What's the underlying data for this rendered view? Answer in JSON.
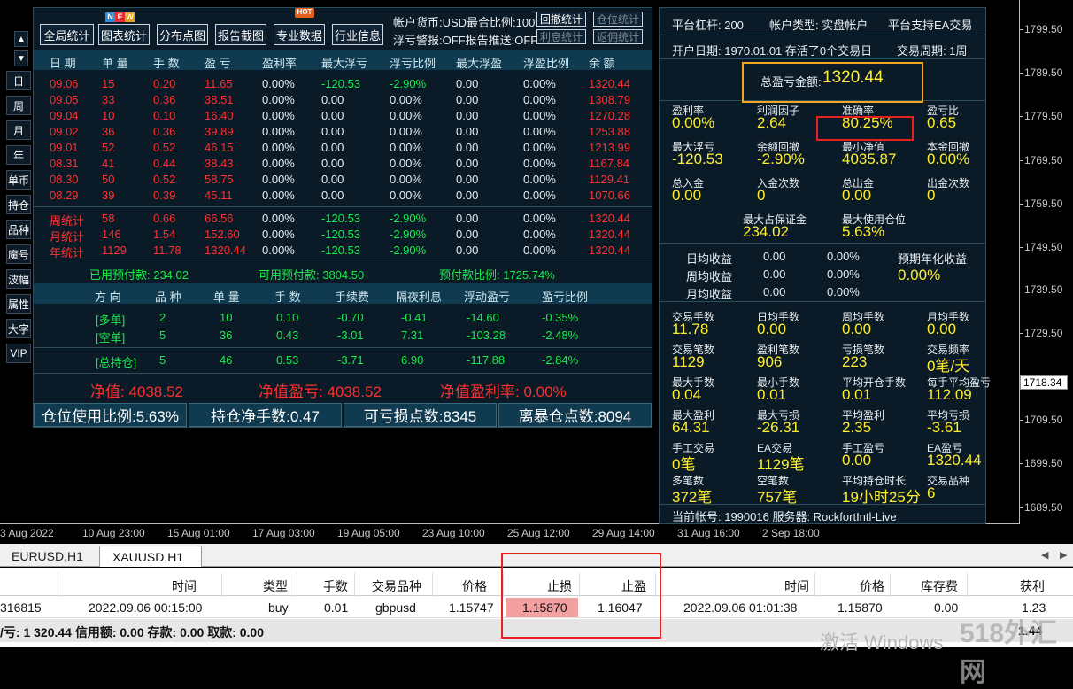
{
  "toolbar": {
    "buttons": [
      "全局统计",
      "图表统计",
      "分布点图",
      "报告截图",
      "专业数据",
      "行业信息"
    ],
    "new_badge": "NEW",
    "hot_badge": "HOT",
    "info_line1": "帐户货币:USD最合比例:100%",
    "info_line2": "浮亏警报:OFF报告推送:OFF",
    "small_btns": [
      "回撤统计",
      "仓位统计",
      "利息统计",
      "返佣统计"
    ]
  },
  "side_buttons": [
    "日",
    "周",
    "月",
    "年",
    "单币",
    "持仓",
    "品种",
    "魔号",
    "波幅",
    "属性",
    "大字",
    "VIP"
  ],
  "daily_table": {
    "headers": [
      "日 期",
      "单 量",
      "手 数",
      "盈 亏",
      "盈利率",
      "最大浮亏",
      "浮亏比例",
      "最大浮盈",
      "浮盈比例",
      "余 额"
    ],
    "rows": [
      [
        "09.06",
        "15",
        "0.20",
        "11.65",
        "0.00%",
        "-120.53",
        "-2.90%",
        "0.00",
        "0.00%",
        "1320.44"
      ],
      [
        "09.05",
        "33",
        "0.36",
        "38.51",
        "0.00%",
        "0.00",
        "0.00%",
        "0.00",
        "0.00%",
        "1308.79"
      ],
      [
        "09.04",
        "10",
        "0.10",
        "16.40",
        "0.00%",
        "0.00",
        "0.00%",
        "0.00",
        "0.00%",
        "1270.28"
      ],
      [
        "09.02",
        "36",
        "0.36",
        "39.89",
        "0.00%",
        "0.00",
        "0.00%",
        "0.00",
        "0.00%",
        "1253.88"
      ],
      [
        "09.01",
        "52",
        "0.52",
        "46.15",
        "0.00%",
        "0.00",
        "0.00%",
        "0.00",
        "0.00%",
        "1213.99"
      ],
      [
        "08.31",
        "41",
        "0.44",
        "38.43",
        "0.00%",
        "0.00",
        "0.00%",
        "0.00",
        "0.00%",
        "1167.84"
      ],
      [
        "08.30",
        "50",
        "0.52",
        "58.75",
        "0.00%",
        "0.00",
        "0.00%",
        "0.00",
        "0.00%",
        "1129.41"
      ],
      [
        "08.29",
        "39",
        "0.39",
        "45.11",
        "0.00%",
        "0.00",
        "0.00%",
        "0.00",
        "0.00%",
        "1070.66"
      ]
    ],
    "summary": [
      [
        "周统计",
        "58",
        "0.66",
        "66.56",
        "0.00%",
        "-120.53",
        "-2.90%",
        "0.00",
        "0.00%",
        "1320.44"
      ],
      [
        "月统计",
        "146",
        "1.54",
        "152.60",
        "0.00%",
        "-120.53",
        "-2.90%",
        "0.00",
        "0.00%",
        "1320.44"
      ],
      [
        "年统计",
        "1129",
        "11.78",
        "1320.44",
        "0.00%",
        "-120.53",
        "-2.90%",
        "0.00",
        "0.00%",
        "1320.44"
      ]
    ]
  },
  "margin": {
    "used": "已用预付款: 234.02",
    "free": "可用预付款: 3804.50",
    "ratio": "预付款比例: 1725.74%"
  },
  "positions": {
    "headers": [
      "方 向",
      "品 种",
      "单 量",
      "手 数",
      "手续费",
      "隔夜利息",
      "浮动盈亏",
      "盈亏比例"
    ],
    "rows": [
      [
        "[多单]",
        "2",
        "10",
        "0.10",
        "-0.70",
        "-0.41",
        "-14.60",
        "-0.35%"
      ],
      [
        "[空单]",
        "5",
        "36",
        "0.43",
        "-3.01",
        "7.31",
        "-103.28",
        "-2.48%"
      ]
    ],
    "total": [
      "[总持仓]",
      "5",
      "46",
      "0.53",
      "-3.71",
      "6.90",
      "-117.88",
      "-2.84%"
    ]
  },
  "equity": {
    "nav": "净值: 4038.52",
    "nav_pl": "净值盈亏: 4038.52",
    "nav_rate": "净值盈利率: 0.00%"
  },
  "bottom_stats": [
    "仓位使用比例:5.63%",
    "持仓净手数:0.47",
    "可亏损点数:8345",
    "离暴仓点数:8094"
  ],
  "right": {
    "row1": [
      "平台杠杆: 200",
      "帐户类型: 实盘帐户",
      "平台支持EA交易"
    ],
    "row2": [
      "开户日期: 1970.01.01 存活了0个交易日",
      "交易周期: 1周"
    ],
    "total_label": "总盈亏金额:",
    "total_value": "1320.44",
    "stats_a": [
      [
        "盈利率",
        "0.00%"
      ],
      [
        "利润因子",
        "2.64"
      ],
      [
        "准确率",
        "80.25%"
      ],
      [
        "盈亏比",
        "0.65"
      ],
      [
        "最大浮亏",
        "-120.53"
      ],
      [
        "余额回撤",
        "-2.90%"
      ],
      [
        "最小净值",
        "4035.87"
      ],
      [
        "本金回撤",
        "0.00%"
      ],
      [
        "总入金",
        "0.00"
      ],
      [
        "入金次数",
        "0"
      ],
      [
        "总出金",
        "0.00"
      ],
      [
        "出金次数",
        "0"
      ]
    ],
    "stats_b": [
      [
        "最大占保证金",
        "234.02"
      ],
      [
        "最大使用仓位",
        "5.63%"
      ]
    ],
    "returns": [
      [
        "日均收益",
        "0.00",
        "0.00%"
      ],
      [
        "周均收益",
        "0.00",
        "0.00%"
      ],
      [
        "月均收益",
        "0.00",
        "0.00%"
      ]
    ],
    "annual_label": "预期年化收益",
    "annual_value": "0.00%",
    "stats_c": [
      [
        "交易手数",
        "11.78"
      ],
      [
        "日均手数",
        "0.00"
      ],
      [
        "周均手数",
        "0.00"
      ],
      [
        "月均手数",
        "0.00"
      ],
      [
        "交易笔数",
        "1129"
      ],
      [
        "盈利笔数",
        "906"
      ],
      [
        "亏损笔数",
        "223"
      ],
      [
        "交易频率",
        "0笔/天"
      ],
      [
        "最大手数",
        "0.04"
      ],
      [
        "最小手数",
        "0.01"
      ],
      [
        "平均开仓手数",
        "0.01"
      ],
      [
        "每手平均盈亏",
        "112.09"
      ],
      [
        "最大盈利",
        "64.31"
      ],
      [
        "最大亏损",
        "-26.31"
      ],
      [
        "平均盈利",
        "2.35"
      ],
      [
        "平均亏损",
        "-3.61"
      ],
      [
        "手工交易",
        "0笔"
      ],
      [
        "EA交易",
        "1129笔"
      ],
      [
        "手工盈亏",
        "0.00"
      ],
      [
        "EA盈亏",
        "1320.44"
      ],
      [
        "多笔数",
        "372笔"
      ],
      [
        "空笔数",
        "757笔"
      ],
      [
        "平均持仓时长",
        "19小时25分"
      ],
      [
        "交易品种",
        "6"
      ]
    ],
    "footer": "当前帐号: 1990016 服务器: RockfortIntl-Live"
  },
  "price_axis": [
    "1799.50",
    "1789.50",
    "1779.50",
    "1769.50",
    "1759.50",
    "1749.50",
    "1739.50",
    "1729.50",
    "1718.34",
    "1709.50",
    "1699.50",
    "1689.50"
  ],
  "time_axis": [
    "3 Aug 2022",
    "10 Aug 23:00",
    "15 Aug 01:00",
    "17 Aug 03:00",
    "19 Aug 05:00",
    "23 Aug 10:00",
    "25 Aug 12:00",
    "29 Aug 14:00",
    "31 Aug 16:00",
    "2 Sep 18:00"
  ],
  "tabs": [
    "EURUSD,H1",
    "XAUUSD,H1"
  ],
  "trade_table": {
    "headers": [
      "时间",
      "类型",
      "手数",
      "交易品种",
      "价格",
      "止损",
      "止盈",
      "时间",
      "价格",
      "库存费",
      "获利"
    ],
    "row": [
      "316815",
      "2022.09.06 00:15:00",
      "buy",
      "0.01",
      "gbpusd",
      "1.15747",
      "1.15870",
      "1.16047",
      "2022.09.06 01:01:38",
      "1.15870",
      "0.00",
      "1.23"
    ],
    "status": "/亏: 1 320.44  信用额: 0.00  存款: 0.00  取款: 0.00",
    "status_right": "1.44"
  },
  "watermark": "激活 Windows",
  "brand": "518外汇网"
}
